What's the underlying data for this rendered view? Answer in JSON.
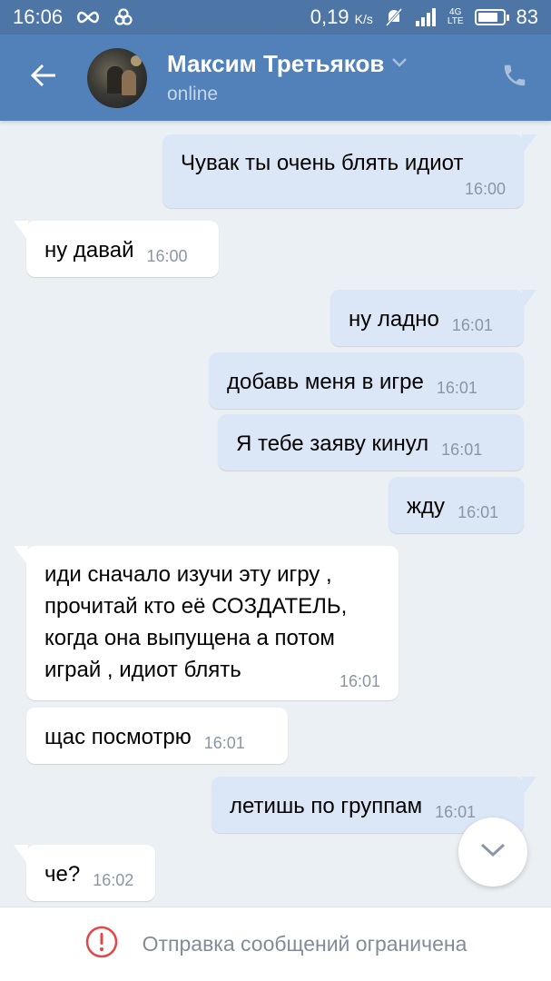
{
  "status_bar": {
    "time": "16:06",
    "network_speed": "0,19",
    "network_speed_unit": "K/s",
    "network_type": "4G",
    "network_sub": "LTE",
    "battery_percent": "83",
    "battery_level": 0.83
  },
  "header": {
    "contact_name": "Максим Третьяков",
    "status": "online"
  },
  "messages": [
    {
      "direction": "out",
      "text": "Чувак ты очень блять идиот",
      "time": "16:00"
    },
    {
      "direction": "in",
      "text": "ну давай",
      "time": "16:00"
    },
    {
      "direction": "out",
      "text": "ну ладно",
      "time": "16:01"
    },
    {
      "direction": "out",
      "text": "добавь меня в игре",
      "time": "16:01"
    },
    {
      "direction": "out",
      "text": "Я тебе заяву кинул",
      "time": "16:01"
    },
    {
      "direction": "out",
      "text": "жду",
      "time": "16:01"
    },
    {
      "direction": "in",
      "lines": [
        "иди сначало изучи эту игру ,",
        "прочитай кто её СОЗДАТЕЛЬ,",
        "когда она выпущена а потом",
        "играй , идиот блять"
      ],
      "time": "16:01"
    },
    {
      "direction": "in",
      "text": "щас посмотрю",
      "time": "16:01"
    },
    {
      "direction": "out",
      "text": "летишь по группам",
      "time": "16:01"
    },
    {
      "direction": "in",
      "text": "че?",
      "time": "16:02"
    }
  ],
  "bottom_bar": {
    "restriction_text": "Отправка сообщений ограничена"
  },
  "colors": {
    "status_bar": "#4d76a6",
    "app_bar": "#5181b8",
    "chat_background": "#ebf0f4",
    "outgoing_bubble": "#dbe7f6",
    "incoming_bubble": "#ffffff",
    "alert_red": "#e64646"
  },
  "icons": {
    "back": "arrow-left-icon",
    "phone": "phone-icon",
    "dropdown": "chevron-down-icon",
    "scroll_down": "chevron-down-icon",
    "alert": "exclamation-circle-icon"
  }
}
